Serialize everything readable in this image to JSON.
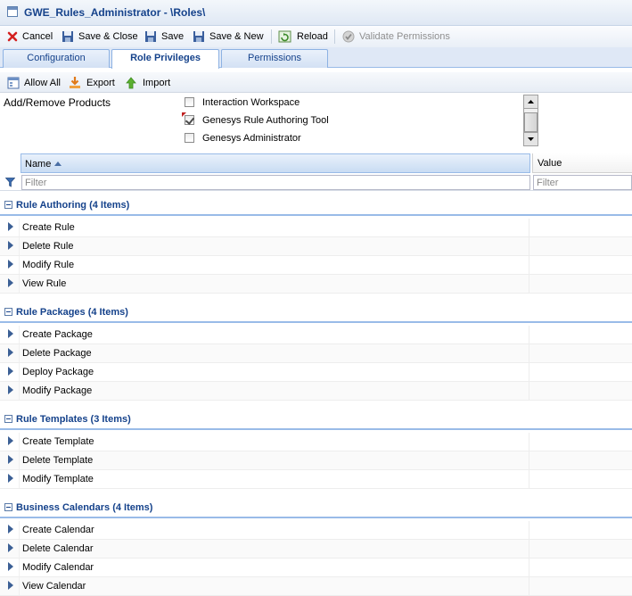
{
  "window": {
    "title": "GWE_Rules_Administrator - \\Roles\\"
  },
  "toolbar": {
    "cancel": "Cancel",
    "save_close": "Save & Close",
    "save": "Save",
    "save_new": "Save & New",
    "reload": "Reload",
    "validate": "Validate Permissions"
  },
  "tabs": [
    "Configuration",
    "Role Privileges",
    "Permissions"
  ],
  "active_tab": "Role Privileges",
  "subtoolbar": {
    "allow_all": "Allow All",
    "export": "Export",
    "import": "Import"
  },
  "products": {
    "label": "Add/Remove Products",
    "items": [
      {
        "label": "Interaction Workspace",
        "checked": false
      },
      {
        "label": "Genesys Rule Authoring Tool",
        "checked": true
      },
      {
        "label": "Genesys Administrator",
        "checked": false
      }
    ]
  },
  "grid": {
    "columns": {
      "name": "Name",
      "value": "Value"
    },
    "filter_placeholder": "Filter",
    "groups": [
      {
        "title": "Rule Authoring (4 Items)",
        "rows": [
          "Create Rule",
          "Delete Rule",
          "Modify Rule",
          "View Rule"
        ]
      },
      {
        "title": "Rule Packages (4 Items)",
        "rows": [
          "Create Package",
          "Delete Package",
          "Deploy Package",
          "Modify Package"
        ]
      },
      {
        "title": "Rule Templates (3 Items)",
        "rows": [
          "Create Template",
          "Delete Template",
          "Modify Template"
        ]
      },
      {
        "title": "Business Calendars (4 Items)",
        "rows": [
          "Create Calendar",
          "Delete Calendar",
          "Modify Calendar",
          "View Calendar"
        ]
      }
    ]
  },
  "colors": {
    "header_blue": "#15428b",
    "tab_border": "#99bbe8"
  }
}
